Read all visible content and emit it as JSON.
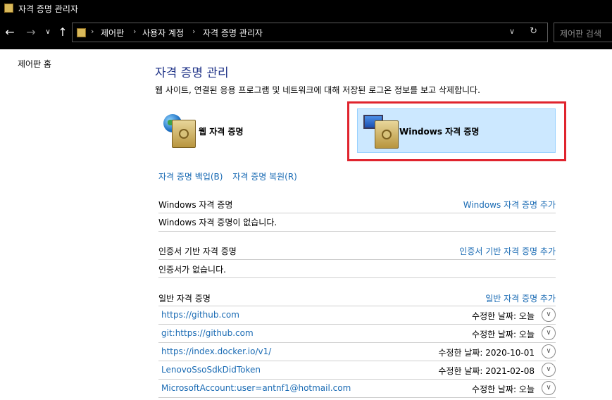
{
  "window": {
    "title": "자격 증명 관리자"
  },
  "address": {
    "breadcrumbs": [
      "제어판",
      "사용자 계정",
      "자격 증명 관리자"
    ],
    "search_placeholder": "제어판 검색"
  },
  "sidebar": {
    "home_link": "제어판 홈"
  },
  "main": {
    "title": "자격 증명 관리",
    "description": "웹 사이트, 연결된 응용 프로그램 및 네트워크에 대해 저장된 로그온 정보를 보고 삭제합니다.",
    "categories": [
      {
        "label": "웹 자격 증명",
        "selected": false
      },
      {
        "label": "Windows 자격 증명",
        "selected": true
      }
    ],
    "backup_link": "자격 증명 백업(B)",
    "restore_link": "자격 증명 복원(R)",
    "sections": {
      "windows": {
        "title": "Windows 자격 증명",
        "add": "Windows 자격 증명 추가",
        "empty": "Windows 자격 증명이 없습니다."
      },
      "certificate": {
        "title": "인증서 기반 자격 증명",
        "add": "인증서 기반 자격 증명 추가",
        "empty": "인증서가 없습니다."
      },
      "generic": {
        "title": "일반 자격 증명",
        "add": "일반 자격 증명 추가",
        "items": [
          {
            "name": "https://github.com",
            "modified": "수정한 날짜:  오늘"
          },
          {
            "name": "git:https://github.com",
            "modified": "수정한 날짜:  오늘"
          },
          {
            "name": "https://index.docker.io/v1/",
            "modified": "수정한 날짜:  2020-10-01"
          },
          {
            "name": "LenovoSsoSdkDidToken",
            "modified": "수정한 날짜:  2021-02-08"
          },
          {
            "name": "MicrosoftAccount:user=antnf1@hotmail.com",
            "modified": "수정한 날짜:  오늘"
          }
        ]
      }
    }
  },
  "colors": {
    "titlebar": "#000000",
    "link": "#1a6bb4",
    "heading": "#1e3287",
    "selected_bg": "#cce8ff",
    "highlight_border": "#e0242e"
  }
}
